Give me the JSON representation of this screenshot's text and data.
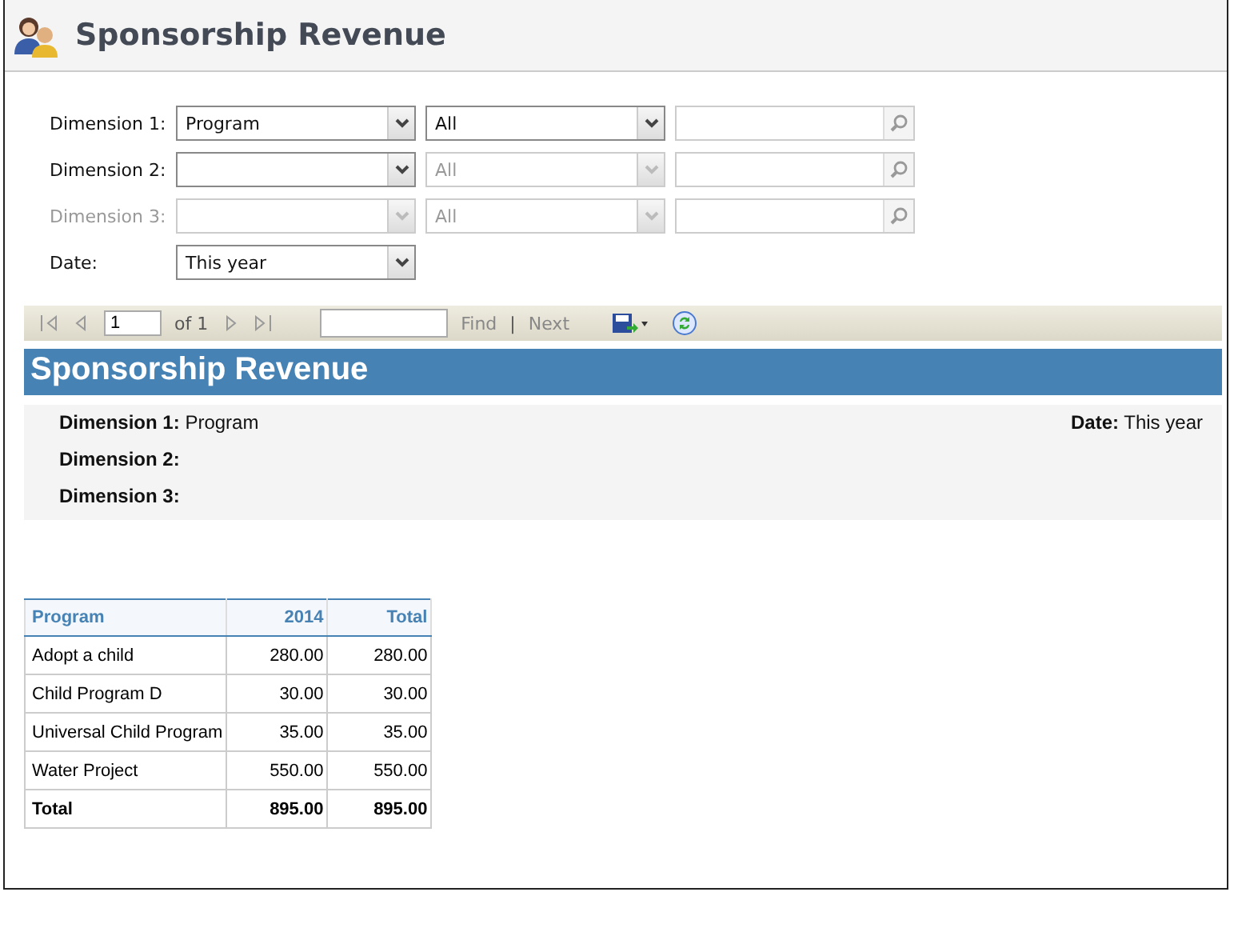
{
  "header": {
    "title": "Sponsorship Revenue"
  },
  "filters": [
    {
      "label": "Dimension 1:",
      "disabled": false,
      "value": "Program",
      "subvalue": "All",
      "subdisabled": false,
      "search": true
    },
    {
      "label": "Dimension 2:",
      "disabled": false,
      "subvalue": "All",
      "subdisabled": true,
      "search": true
    },
    {
      "label": "Dimension 3:",
      "disabled": true,
      "subvalue": "All",
      "subdisabled": true,
      "search": true
    },
    {
      "label": "Date:",
      "disabled": false,
      "value": "This year",
      "search": false
    }
  ],
  "toolbar": {
    "page": "1",
    "of": "of 1",
    "find": "Find",
    "sep": "|",
    "next": "Next"
  },
  "report": {
    "title": "Sponsorship Revenue",
    "params": [
      {
        "label": "Dimension 1:",
        "value": "Program"
      },
      {
        "label": "Dimension 2:"
      },
      {
        "label": "Dimension 3:"
      }
    ],
    "date": {
      "label": "Date:",
      "value": "This year"
    }
  },
  "table": {
    "columns": [
      "Program",
      "2014",
      "Total"
    ],
    "rows": [
      {
        "cells": [
          "Adopt a child",
          "280.00",
          "280.00"
        ],
        "total": false
      },
      {
        "cells": [
          "Child Program D",
          "30.00",
          "30.00"
        ],
        "total": false
      },
      {
        "cells": [
          "Universal Child Program",
          "35.00",
          "35.00"
        ],
        "total": false
      },
      {
        "cells": [
          "Water Project",
          "550.00",
          "550.00"
        ],
        "total": false
      },
      {
        "cells": [
          "Total",
          "895.00",
          "895.00"
        ],
        "total": true
      }
    ]
  }
}
